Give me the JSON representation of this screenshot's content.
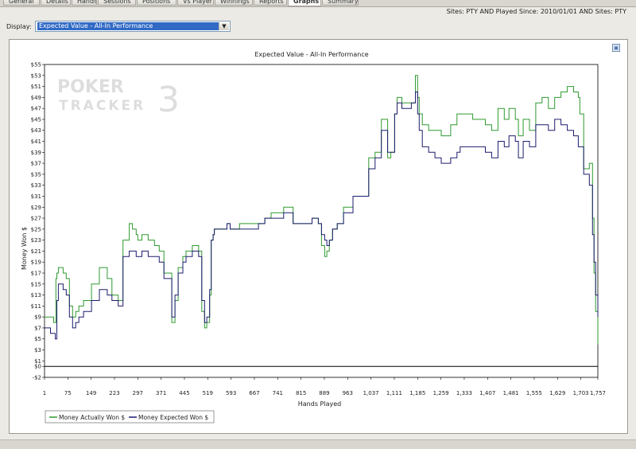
{
  "tabs": [
    {
      "label": "General",
      "active": false
    },
    {
      "label": "Details",
      "active": false
    },
    {
      "label": "Hands",
      "active": false
    },
    {
      "label": "Sessions",
      "active": false
    },
    {
      "label": "Positions",
      "active": false
    },
    {
      "label": "Vs Player",
      "active": false
    },
    {
      "label": "Winnings",
      "active": false
    },
    {
      "label": "Reports",
      "active": false
    },
    {
      "label": "Graphs",
      "active": true
    },
    {
      "label": "Summary",
      "active": false
    }
  ],
  "filter": {
    "text": "Sites: PTY AND Played Since: 2010/01/01 AND Sites: PTY"
  },
  "display": {
    "label": "Display:",
    "selected": "Expected Value - All-In Performance"
  },
  "icons": {
    "dropdown": "chevron-down-icon",
    "maximize": "maximize-icon"
  },
  "watermark": {
    "line1": "POKER",
    "line2": "TRACKER",
    "mark": "3"
  },
  "colors": {
    "actual": "#2f9a2f",
    "expected": "#1c1c6e",
    "zero_line": "#000000"
  },
  "chart_data": {
    "type": "line",
    "title": "Expected Value - All-In Performance",
    "xlabel": "Hands Played",
    "ylabel": "Money Won $",
    "xlim": [
      1,
      1757
    ],
    "ylim": [
      -2,
      55
    ],
    "x_ticks": [
      1,
      75,
      149,
      223,
      297,
      371,
      445,
      519,
      593,
      667,
      741,
      815,
      889,
      963,
      1037,
      1111,
      1185,
      1259,
      1333,
      1407,
      1481,
      1555,
      1629,
      1703,
      1757
    ],
    "x_tick_labels": [
      "1",
      "75",
      "149",
      "223",
      "297",
      "371",
      "445",
      "519",
      "593",
      "667",
      "741",
      "815",
      "889",
      "963",
      "1,037",
      "1,111",
      "1,185",
      "1,259",
      "1,333",
      "1,407",
      "1,481",
      "1,555",
      "1,629",
      "1,703",
      "1,757"
    ],
    "y_ticks": [
      -2,
      0,
      1,
      3,
      5,
      7,
      9,
      11,
      13,
      15,
      17,
      19,
      21,
      23,
      25,
      27,
      29,
      31,
      33,
      35,
      37,
      39,
      41,
      43,
      45,
      47,
      49,
      51,
      53,
      55
    ],
    "y_tick_labels": [
      "-$2",
      "$0",
      "$1",
      "$3",
      "$5",
      "$7",
      "$9",
      "$11",
      "$13",
      "$15",
      "$17",
      "$19",
      "$21",
      "$23",
      "$25",
      "$27",
      "$29",
      "$31",
      "$33",
      "$35",
      "$37",
      "$39",
      "$41",
      "$43",
      "$45",
      "$47",
      "$49",
      "$51",
      "$53",
      "$55"
    ],
    "grid": false,
    "legend_position": "bottom-left",
    "series": [
      {
        "name": "Money Actually Won $",
        "color": "#2f9a2f",
        "x": [
          1,
          30,
          37,
          40,
          45,
          60,
          70,
          80,
          90,
          100,
          110,
          125,
          150,
          175,
          200,
          215,
          235,
          250,
          270,
          280,
          292,
          297,
          310,
          330,
          350,
          365,
          380,
          405,
          415,
          425,
          440,
          450,
          470,
          490,
          500,
          509,
          516,
          525,
          530,
          536,
          540,
          548,
          560,
          580,
          590,
          600,
          620,
          650,
          680,
          700,
          720,
          760,
          790,
          820,
          850,
          870,
          880,
          890,
          897,
          905,
          915,
          930,
          950,
          980,
          1010,
          1030,
          1050,
          1070,
          1090,
          1100,
          1112,
          1120,
          1135,
          1165,
          1178,
          1185,
          1190,
          1200,
          1220,
          1240,
          1260,
          1290,
          1310,
          1320,
          1360,
          1400,
          1420,
          1440,
          1460,
          1475,
          1495,
          1505,
          1520,
          1540,
          1560,
          1580,
          1600,
          1620,
          1640,
          1660,
          1680,
          1695,
          1700,
          1712,
          1730,
          1740,
          1745,
          1750,
          1757
        ],
        "y": [
          9,
          8,
          16,
          17,
          18,
          17,
          16,
          11,
          9,
          10,
          11,
          12,
          15,
          18,
          16,
          13,
          12,
          23,
          26,
          25,
          24,
          23,
          24,
          23,
          22,
          21,
          17,
          8,
          12,
          18,
          20,
          21,
          22,
          21,
          10,
          7,
          8,
          13,
          23,
          24,
          25,
          25,
          25,
          26,
          25,
          25,
          26,
          26,
          26,
          27,
          28,
          29,
          26,
          26,
          27,
          26,
          22,
          20,
          21,
          23,
          25,
          26,
          29,
          31,
          31,
          38,
          39,
          45,
          38,
          39,
          46,
          49,
          48,
          48,
          53,
          49,
          46,
          44,
          43,
          43,
          42,
          44,
          46,
          46,
          45,
          44,
          43,
          47,
          45,
          47,
          45,
          42,
          45,
          43,
          48,
          49,
          47,
          49,
          50,
          51,
          50,
          49,
          46,
          36,
          37,
          27,
          17,
          10,
          4
        ]
      },
      {
        "name": "Money Expected Won $",
        "color": "#1c1c6e",
        "x": [
          1,
          20,
          35,
          40,
          45,
          60,
          70,
          80,
          90,
          100,
          110,
          125,
          150,
          175,
          200,
          215,
          235,
          250,
          270,
          280,
          292,
          297,
          310,
          330,
          350,
          365,
          380,
          405,
          415,
          425,
          440,
          450,
          470,
          490,
          500,
          509,
          516,
          525,
          530,
          536,
          540,
          548,
          560,
          580,
          590,
          600,
          620,
          650,
          680,
          700,
          720,
          760,
          790,
          820,
          850,
          870,
          880,
          890,
          897,
          905,
          915,
          930,
          950,
          980,
          1010,
          1030,
          1050,
          1070,
          1090,
          1100,
          1112,
          1120,
          1135,
          1165,
          1178,
          1185,
          1190,
          1200,
          1220,
          1240,
          1260,
          1290,
          1310,
          1320,
          1360,
          1400,
          1420,
          1440,
          1460,
          1475,
          1495,
          1505,
          1520,
          1540,
          1560,
          1580,
          1600,
          1620,
          1640,
          1660,
          1680,
          1695,
          1700,
          1712,
          1730,
          1740,
          1745,
          1750,
          1757
        ],
        "y": [
          7,
          6,
          5,
          12,
          15,
          14,
          13,
          9,
          7,
          8,
          9,
          10,
          12,
          14,
          13,
          12,
          11,
          20,
          21,
          21,
          20,
          20,
          21,
          20,
          20,
          19,
          16,
          9,
          13,
          17,
          19,
          20,
          21,
          20,
          12,
          8,
          9,
          14,
          23,
          24,
          25,
          25,
          25,
          26,
          25,
          25,
          25,
          25,
          26,
          27,
          27,
          28,
          26,
          26,
          27,
          26,
          24,
          23,
          22,
          23,
          25,
          26,
          28,
          31,
          31,
          36,
          38,
          43,
          39,
          39,
          46,
          48,
          47,
          48,
          50,
          46,
          43,
          40,
          39,
          38,
          37,
          38,
          39,
          40,
          40,
          39,
          38,
          41,
          40,
          42,
          41,
          38,
          41,
          40,
          44,
          44,
          43,
          45,
          44,
          43,
          42,
          40,
          40,
          35,
          33,
          24,
          19,
          13,
          9
        ]
      }
    ]
  }
}
